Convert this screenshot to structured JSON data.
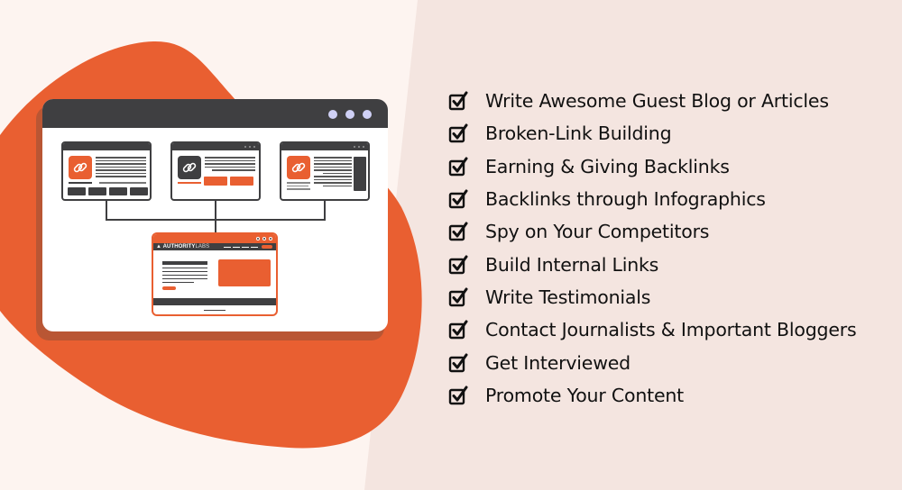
{
  "colors": {
    "background_right": "#f4e5e0",
    "background_left": "#fdf4f0",
    "accent_orange": "#e95f31",
    "accent_orange_shadow": "#b95634",
    "dark_gray": "#3f3f41",
    "window_dot": "#cfd0f5",
    "text": "#111111"
  },
  "illustration": {
    "main_window": {
      "titlebar_dots": 3,
      "icon": "browser-window-icon"
    },
    "sites": [
      {
        "name": "site-1",
        "logo_color": "orange",
        "logo_icon": "chain-link-icon"
      },
      {
        "name": "site-2",
        "logo_color": "dark",
        "logo_icon": "chain-link-icon"
      },
      {
        "name": "site-3",
        "logo_color": "orange",
        "logo_icon": "chain-link-icon"
      }
    ],
    "target_site": {
      "brand_bold": "AUTHORITY",
      "brand_light": "LABS",
      "logo_icon": "authoritylabs-logo-icon"
    }
  },
  "checklist": {
    "icon": "checked-box-icon",
    "items": [
      {
        "label": "Write Awesome Guest Blog or Articles"
      },
      {
        "label": "Broken-Link Building"
      },
      {
        "label": "Earning & Giving Backlinks"
      },
      {
        "label": "Backlinks through Infographics"
      },
      {
        "label": "Spy on Your Competitors"
      },
      {
        "label": "Build Internal Links"
      },
      {
        "label": "Write Testimonials"
      },
      {
        "label": "Contact Journalists & Important Bloggers"
      },
      {
        "label": "Get Interviewed"
      },
      {
        "label": "Promote Your Content"
      }
    ]
  }
}
